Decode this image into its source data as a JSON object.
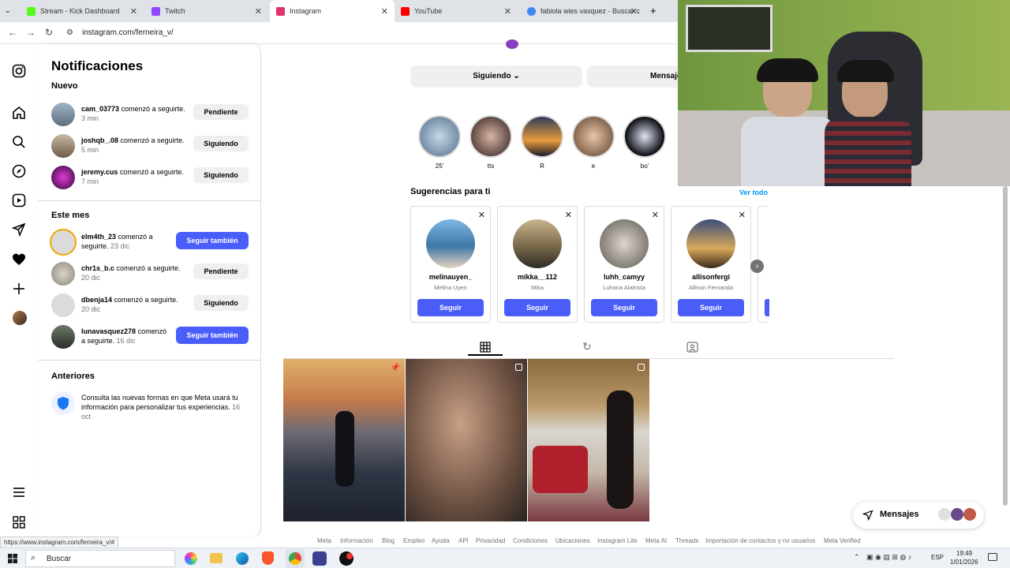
{
  "browser": {
    "tabs": [
      {
        "label": "Stream - Kick Dashboard",
        "color": "#53fc18"
      },
      {
        "label": "Twitch",
        "color": "#9146ff"
      },
      {
        "label": "Instagram",
        "color": "#e1306c"
      },
      {
        "label": "YouTube",
        "color": "#ff0000"
      },
      {
        "label": "fabiola wies vasquez - Buscar c",
        "color": "#4285f4"
      }
    ],
    "url": "instagram.com/ferneira_v/",
    "status_url": "https://www.instagram.com/ferneira_v/#"
  },
  "notifications": {
    "title": "Notificaciones",
    "section_new": "Nuevo",
    "section_month": "Este mes",
    "section_older": "Anteriores",
    "new_items": [
      {
        "user": "cam_03773",
        "text": "comenzó a seguirte.",
        "time": "3 min",
        "button": "Pendiente"
      },
      {
        "user": "joshqb_.08",
        "text": "comenzó a seguirte.",
        "time": "5 min",
        "button": "Siguiendo"
      },
      {
        "user": "jeremy.cus",
        "text": "comenzó a seguirte.",
        "time": "7 min",
        "button": "Siguiendo"
      }
    ],
    "month_items": [
      {
        "user": "elm4th_23",
        "text": "comenzó a seguirte.",
        "time": "23 dic",
        "button": "Seguir también"
      },
      {
        "user": "chr1s_b.c",
        "text": "comenzó a seguirte.",
        "time": "20 dic",
        "button": "Pendiente"
      },
      {
        "user": "dbenja14",
        "text": "comenzó a seguirte.",
        "time": "20 dic",
        "button": "Siguiendo"
      },
      {
        "user": "lunavasquez278",
        "text": "comenzó a seguirte.",
        "time": "16 dic",
        "button": "Seguir también"
      }
    ],
    "older_item": {
      "text": "Consulta las nuevas formas en que Meta usará tu información para personalizar tus experiencias.",
      "time": "16 oct"
    }
  },
  "profile": {
    "following_button": "Siguiendo",
    "message_button": "Mensaje",
    "highlights": [
      "25'",
      "tts",
      "R",
      "e",
      "bo'"
    ],
    "suggestions_title": "Sugerencias para ti",
    "see_all": "Ver todo",
    "suggestions": [
      {
        "user": "melinauyen_",
        "name": "Melina Uyen",
        "button": "Seguir"
      },
      {
        "user": "mikka__112",
        "name": "Mika",
        "button": "Seguir"
      },
      {
        "user": "luhh_camyy",
        "name": "Luhana Alatrista",
        "button": "Seguir"
      },
      {
        "user": "allisonfergi",
        "name": "Allison Fernanda",
        "button": "Seguir"
      }
    ],
    "footer_links": [
      "Meta",
      "Información",
      "Blog",
      "Empleo",
      "Ayuda",
      "API",
      "Privacidad",
      "Condiciones",
      "Ubicaciones",
      "Instagram Lite",
      "Meta AI",
      "Threads",
      "Importación de contactos y no usuarios",
      "Meta Verified"
    ],
    "messages_label": "Mensajes"
  },
  "taskbar": {
    "search_placeholder": "Buscar",
    "lang": "ESP",
    "time": "19:49",
    "date": "1/01/2026"
  }
}
